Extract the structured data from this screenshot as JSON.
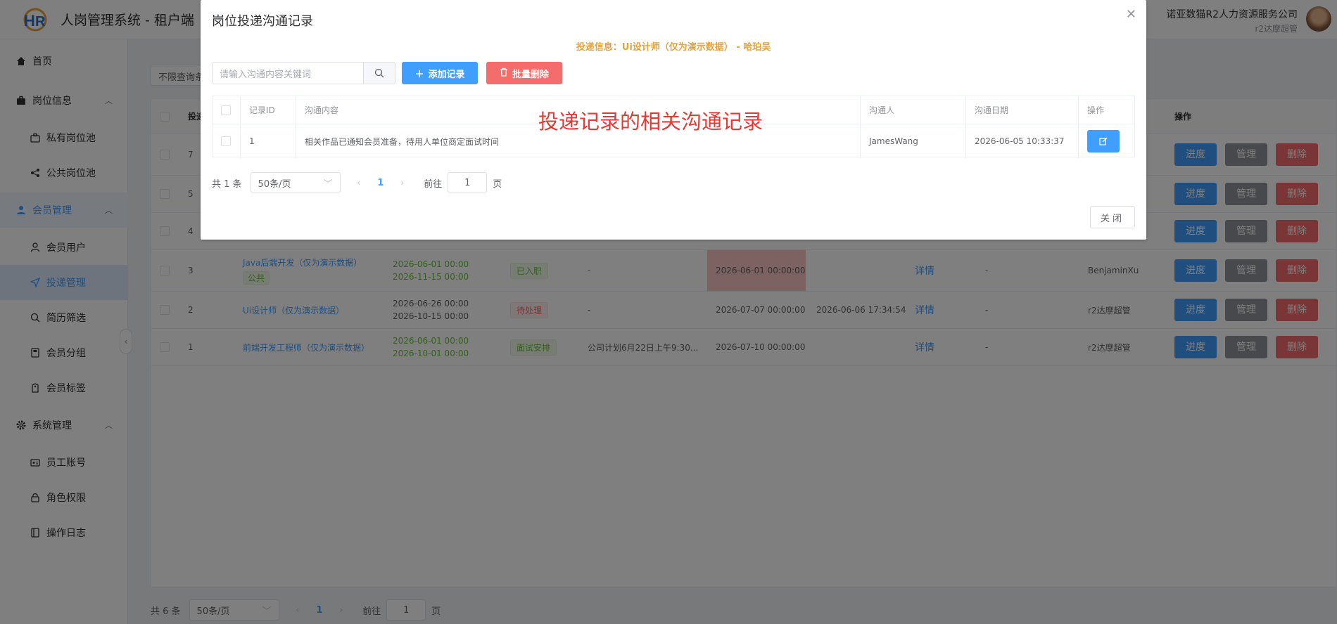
{
  "header": {
    "app_title": "人岗管理系统 - 租户端",
    "company_name": "诺亚数猫R2人力资源服务公司",
    "company_user": "r2达摩超管"
  },
  "sidebar": {
    "home": "首页",
    "job_group": "岗位信息",
    "private_pool": "私有岗位池",
    "public_pool": "公共岗位池",
    "member_group": "会员管理",
    "member_users": "会员用户",
    "delivery": "投递管理",
    "resume_filter": "简历筛选",
    "member_groups": "会员分组",
    "member_tags": "会员标签",
    "system_group": "系统管理",
    "staff_account": "员工账号",
    "role_perm": "角色权限",
    "op_log": "操作日志"
  },
  "main": {
    "filter_text": "不限查询条",
    "col_id": "投递",
    "col_action": "操作",
    "rows": [
      {
        "id": "7"
      },
      {
        "id": "5"
      },
      {
        "id": "4"
      },
      {
        "id": "3",
        "job": "Java后端开发（仅为演示数据）",
        "job_tag": "公共",
        "start": "2026-06-01 00:00",
        "end": "2026-11-15 00:00",
        "status": "已入职",
        "remark": "-",
        "interview": "2026-06-01 00:00:00",
        "time2": "",
        "detail": "详情",
        "extra": "-",
        "owner": "BenjaminXu"
      },
      {
        "id": "2",
        "job": "Ui设计师（仅为演示数据）",
        "start": "2026-06-26 00:00",
        "end": "2026-10-15 00:00",
        "status": "待处理",
        "remark": "-",
        "interview": "2026-07-07 00:00:00",
        "time2": "2026-06-06 17:34:54",
        "detail": "详情",
        "extra": "-",
        "owner": "r2达摩超管"
      },
      {
        "id": "1",
        "job": "前端开发工程师（仅为演示数据）",
        "start": "2026-06-01 00:00",
        "end": "2026-10-01 00:00",
        "status": "面试安排",
        "remark": "公司计划6月22日上午9:30...",
        "interview": "2026-07-10 00:00:00",
        "time2": "",
        "detail": "详情",
        "extra": "-",
        "owner": "r2达摩超管"
      }
    ],
    "btn_progress": "进度",
    "btn_manage": "管理",
    "btn_delete": "删除",
    "pager": {
      "total": "共 6 条",
      "page_size": "50条/页",
      "current": "1",
      "goto": "前往",
      "goto_value": "1",
      "page_unit": "页"
    }
  },
  "dialog": {
    "title": "岗位投递沟通记录",
    "info": "投递信息：Ui设计师（仅为演示数据） - 哈珀吴",
    "search_placeholder": "请输入沟通内容关键词",
    "add_btn": "添加记录",
    "batch_delete_btn": "批量删除",
    "columns": {
      "id": "记录ID",
      "content": "沟通内容",
      "person": "沟通人",
      "date": "沟通日期",
      "action": "操作"
    },
    "row": {
      "id": "1",
      "content": "相关作品已通知会员准备，待用人单位商定面试时间",
      "person": "JamesWang",
      "date": "2026-06-05 10:33:37"
    },
    "annotation": "投递记录的相关沟通记录",
    "pager": {
      "total": "共 1 条",
      "page_size": "50条/页",
      "current": "1",
      "goto": "前往",
      "goto_value": "1",
      "page_unit": "页"
    },
    "close_btn": "关闭"
  },
  "colors": {
    "primary": "#409eff",
    "danger": "#f56c6c",
    "success": "#67c23a",
    "warning": "#e6a23c",
    "annotation": "#e53935"
  }
}
